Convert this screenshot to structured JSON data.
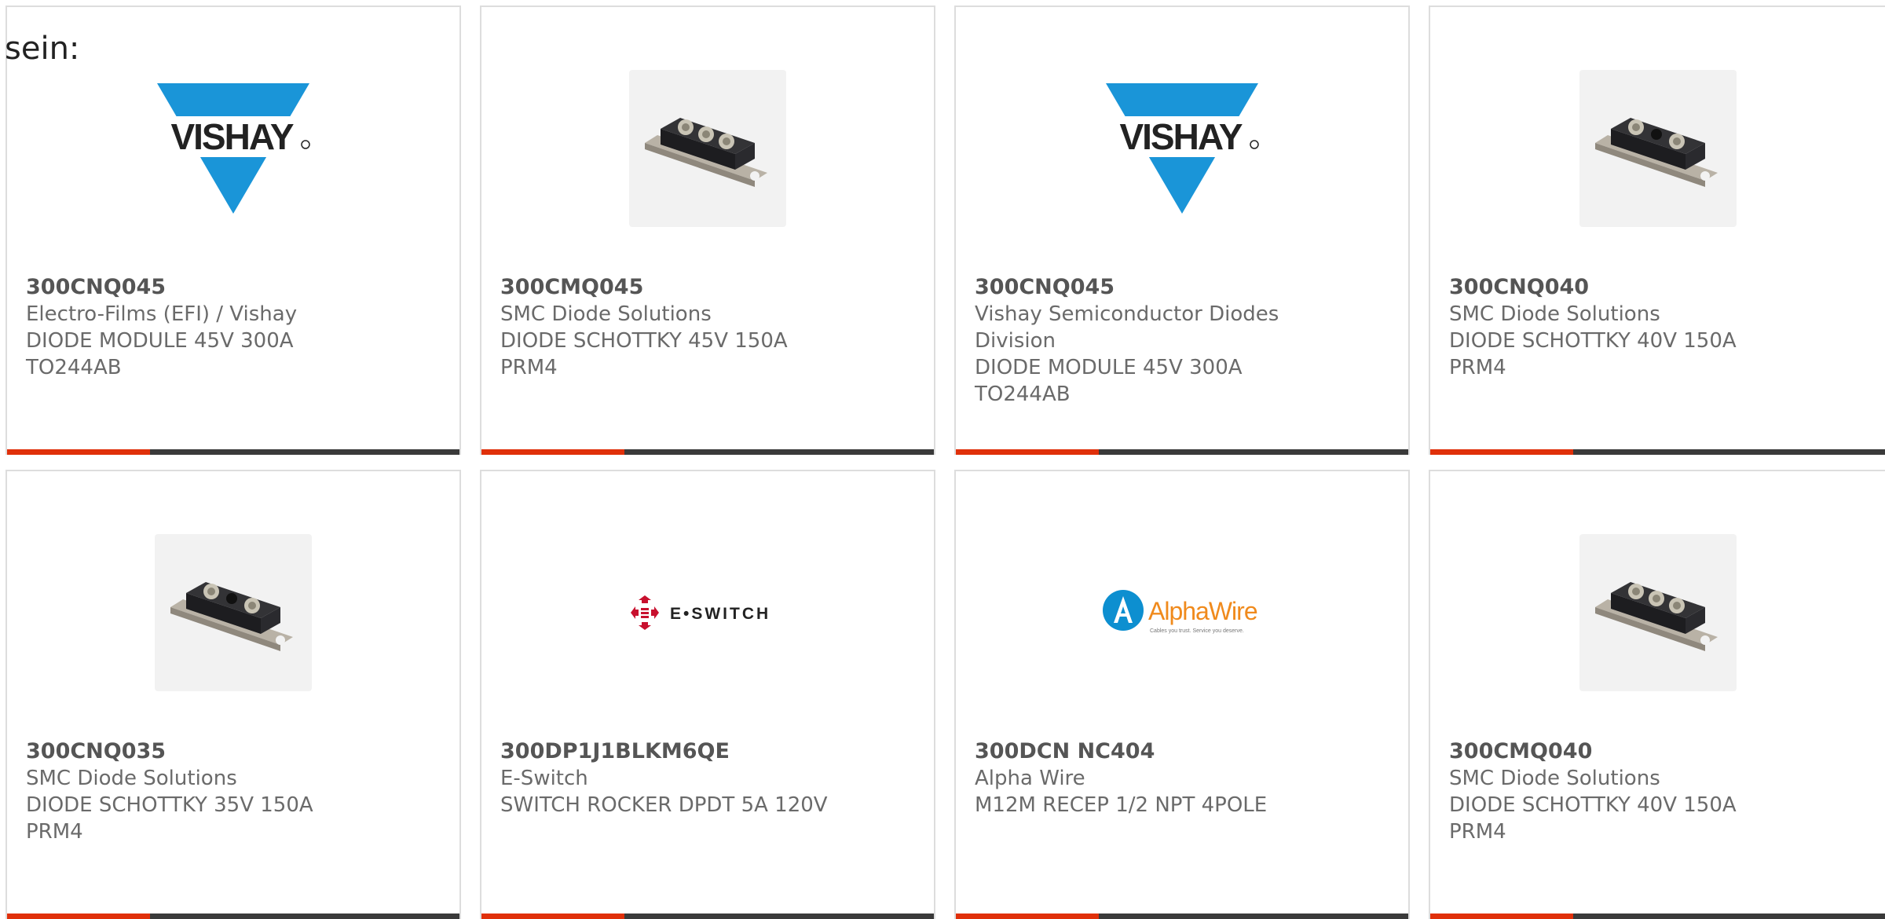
{
  "lead_text": "sein:",
  "colors": {
    "accent": "#e0300a",
    "bar_dark": "#3a3a3a",
    "vishay_blue": "#1a95d8",
    "eswitch_red": "#c8102e",
    "alphawire_blue": "#0d8fd0",
    "alphawire_orange": "#f08a1c"
  },
  "logos": {
    "vishay": "VISHAY",
    "eswitch": "E•SWITCH",
    "alphawire": "AlphaWire",
    "alphawire_tagline": "Cables you trust. Service you deserve."
  },
  "products": [
    {
      "part_number": "300CNQ045",
      "manufacturer": "Electro-Films (EFI) / Vishay",
      "description": "DIODE MODULE 45V 300A TO244AB",
      "image": "vishay-logo"
    },
    {
      "part_number": "300CMQ045",
      "manufacturer": "SMC Diode Solutions",
      "description": "DIODE SCHOTTKY 45V 150A PRM4",
      "image": "diode-module-photo"
    },
    {
      "part_number": "300CNQ045",
      "manufacturer": "Vishay Semiconductor Diodes Division",
      "description": "DIODE MODULE 45V 300A TO244AB",
      "image": "vishay-logo"
    },
    {
      "part_number": "300CNQ040",
      "manufacturer": "SMC Diode Solutions",
      "description": "DIODE SCHOTTKY 40V 150A PRM4",
      "image": "diode-module-photo"
    },
    {
      "part_number": "300CNQ035",
      "manufacturer": "SMC Diode Solutions",
      "description": "DIODE SCHOTTKY 35V 150A PRM4",
      "image": "diode-module-photo"
    },
    {
      "part_number": "300DP1J1BLKM6QE",
      "manufacturer": "E-Switch",
      "description": "SWITCH ROCKER DPDT 5A 120V",
      "image": "eswitch-logo"
    },
    {
      "part_number": "300DCN NC404",
      "manufacturer": "Alpha Wire",
      "description": "M12M RECEP 1/2 NPT 4POLE",
      "image": "alphawire-logo"
    },
    {
      "part_number": "300CMQ040",
      "manufacturer": "SMC Diode Solutions",
      "description": "DIODE SCHOTTKY 40V 150A PRM4",
      "image": "diode-module-photo"
    }
  ]
}
